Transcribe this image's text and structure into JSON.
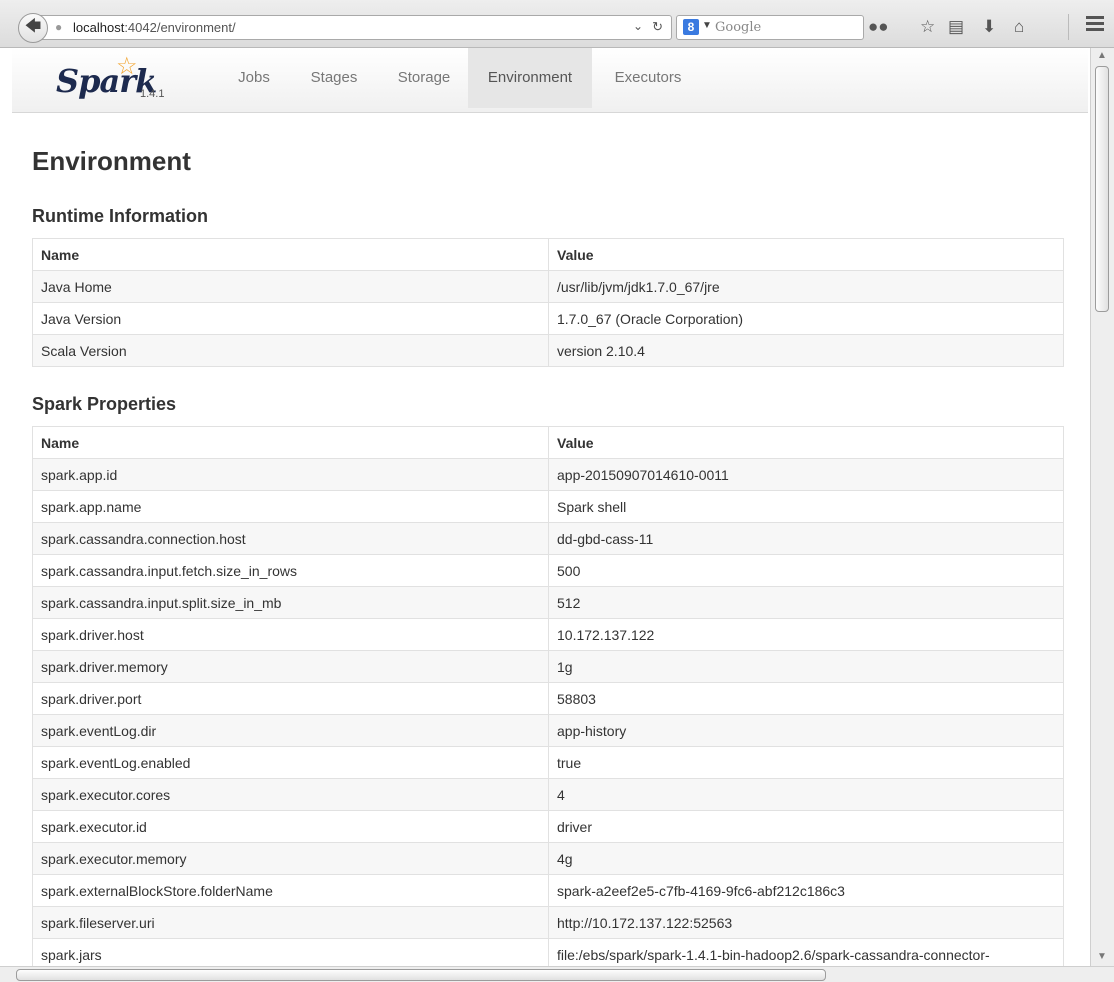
{
  "browser": {
    "url_host": "localhost",
    "url_path": ":4042/environment/",
    "search_placeholder": "Google",
    "search_engine_letter": "8"
  },
  "navbar": {
    "logo": "Spark",
    "version": "1.4.1",
    "tabs": [
      {
        "label": "Jobs",
        "active": false
      },
      {
        "label": "Stages",
        "active": false
      },
      {
        "label": "Storage",
        "active": false
      },
      {
        "label": "Environment",
        "active": true
      },
      {
        "label": "Executors",
        "active": false
      }
    ]
  },
  "page_title": "Environment",
  "runtime": {
    "heading": "Runtime Information",
    "columns": [
      "Name",
      "Value"
    ],
    "rows": [
      [
        "Java Home",
        "/usr/lib/jvm/jdk1.7.0_67/jre"
      ],
      [
        "Java Version",
        "1.7.0_67 (Oracle Corporation)"
      ],
      [
        "Scala Version",
        "version 2.10.4"
      ]
    ]
  },
  "spark_properties": {
    "heading": "Spark Properties",
    "columns": [
      "Name",
      "Value"
    ],
    "rows": [
      [
        "spark.app.id",
        "app-20150907014610-0011"
      ],
      [
        "spark.app.name",
        "Spark shell"
      ],
      [
        "spark.cassandra.connection.host",
        "dd-gbd-cass-11"
      ],
      [
        "spark.cassandra.input.fetch.size_in_rows",
        "500"
      ],
      [
        "spark.cassandra.input.split.size_in_mb",
        "512"
      ],
      [
        "spark.driver.host",
        "10.172.137.122"
      ],
      [
        "spark.driver.memory",
        "1g"
      ],
      [
        "spark.driver.port",
        "58803"
      ],
      [
        "spark.eventLog.dir",
        "app-history"
      ],
      [
        "spark.eventLog.enabled",
        "true"
      ],
      [
        "spark.executor.cores",
        "4"
      ],
      [
        "spark.executor.id",
        "driver"
      ],
      [
        "spark.executor.memory",
        "4g"
      ],
      [
        "spark.externalBlockStore.folderName",
        "spark-a2eef2e5-c7fb-4169-9fc6-abf212c186c3"
      ],
      [
        "spark.fileserver.uri",
        "http://10.172.137.122:52563"
      ],
      [
        "spark.jars",
        "file:/ebs/spark/spark-1.4.1-bin-hadoop2.6/spark-cassandra-connector-"
      ]
    ]
  }
}
